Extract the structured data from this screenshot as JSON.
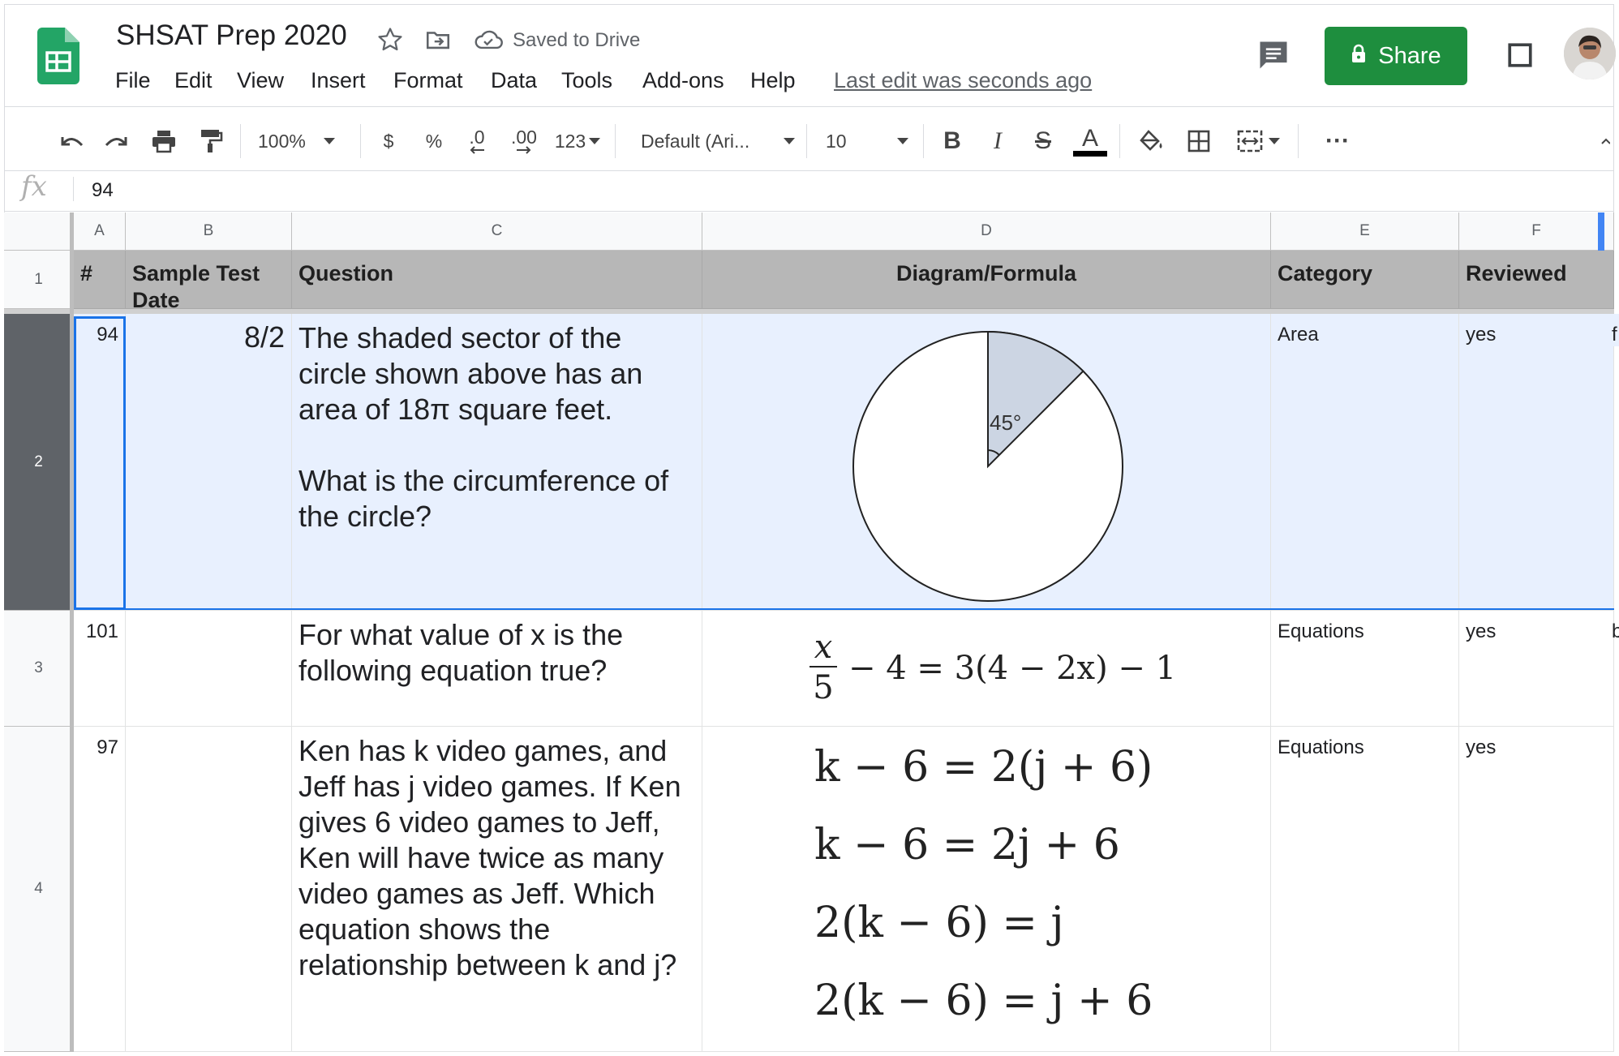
{
  "document": {
    "title": "SHSAT Prep 2020",
    "saved_status": "Saved to Drive",
    "last_edit": "Last edit was seconds ago"
  },
  "menu": [
    "File",
    "Edit",
    "View",
    "Insert",
    "Format",
    "Data",
    "Tools",
    "Add-ons",
    "Help"
  ],
  "header_actions": {
    "share_label": "Share"
  },
  "toolbar": {
    "zoom": "100%",
    "currency": "$",
    "percent": "%",
    "decrease_decimal": ".0",
    "increase_decimal": ".00",
    "more_formats": "123",
    "font": "Default (Ari...",
    "font_size": "10",
    "bold": "B",
    "italic": "I",
    "strikethrough": "S",
    "text_color": "A",
    "more": "···"
  },
  "formula_bar": {
    "label": "fx",
    "value": "94"
  },
  "columns": [
    "A",
    "B",
    "C",
    "D",
    "E",
    "F"
  ],
  "row_numbers": [
    "1",
    "2",
    "3",
    "4"
  ],
  "header_row": {
    "a": "#",
    "b": "Sample Test Date",
    "c": "Question",
    "d": "Diagram/Formula",
    "e": "Category",
    "f": "Reviewed"
  },
  "rows": [
    {
      "id": "94",
      "date": "8/2",
      "question": "The shaded sector of the circle shown above has an area of 18π square feet.\n\nWhat is the circumference of the circle?",
      "diagram_angle": "45°",
      "category": "Area",
      "reviewed": "yes",
      "overflow": "f"
    },
    {
      "id": "101",
      "date": "",
      "question": "For what value of x is the following equation true?",
      "formula": {
        "numerator": "x",
        "denominator": "5",
        "rest": "− 4 = 3(4 − 2x) − 1"
      },
      "category": "Equations",
      "reviewed": "yes",
      "overflow": "b"
    },
    {
      "id": "97",
      "date": "",
      "question": "Ken has k video games, and Jeff has j video games. If Ken gives 6 video games to Jeff, Ken will have twice as many video games as Jeff. Which equation shows the relationship between k and j?",
      "choices": [
        "k − 6 = 2(j + 6)",
        "k − 6 = 2j + 6",
        "2(k − 6) = j",
        "2(k − 6) = j + 6"
      ],
      "category": "Equations",
      "reviewed": "yes"
    }
  ],
  "colors": {
    "share": "#1e8e3e",
    "selection": "#1a73e8",
    "header_fill": "#b7b7b7",
    "selected_row": "#e8f0fe"
  }
}
